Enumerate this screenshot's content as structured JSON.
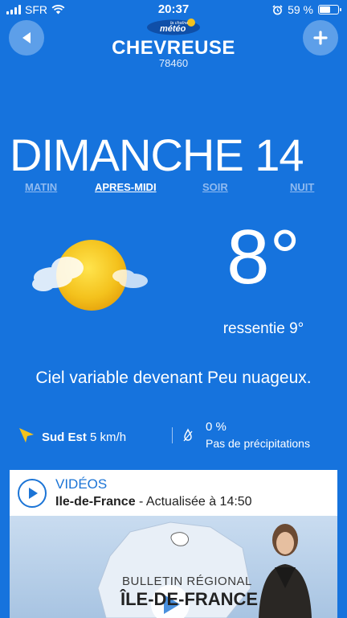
{
  "status_bar": {
    "carrier": "SFR",
    "time": "20:37",
    "battery": "59 %",
    "battery_level": 0.59,
    "icons": [
      "signal-icon",
      "wifi-icon",
      "alarm-icon",
      "battery-icon"
    ]
  },
  "header": {
    "logo_text_top": "la chaîne",
    "logo_text_main": "météo",
    "city": "CHEVREUSE",
    "postal_code": "78460",
    "back_icon": "back-arrow-icon",
    "add_icon": "plus-icon"
  },
  "day": "DIMANCHE 14",
  "tabs": [
    {
      "label": "MATIN",
      "active": false
    },
    {
      "label": "APRES-MIDI",
      "active": true
    },
    {
      "label": "SOIR",
      "active": false
    },
    {
      "label": "NUIT",
      "active": false
    }
  ],
  "weather": {
    "icon": "sun-cloud-icon",
    "temperature": "8°",
    "feels_like": "ressentie 9°",
    "summary": "Ciel variable devenant Peu nuageux."
  },
  "wind": {
    "direction": "Sud Est",
    "speed": "5 km/h",
    "icon": "wind-direction-icon"
  },
  "rain": {
    "probability": "0 %",
    "text": "Pas de précipitations",
    "icon": "umbrella-drop-icon"
  },
  "video_card": {
    "title": "VIDÉOS",
    "region": "Ile-de-France",
    "updated": " - Actualisée à 14:50",
    "thumb_line1": "BULLETIN RÉGIONAL",
    "thumb_line2": "ÎLE-DE-FRANCE"
  },
  "colors": {
    "background": "#1673dd",
    "button": "#5d9fe9",
    "inactive_tab": "#8fbaf0",
    "accent_yellow": "#f4c21d",
    "card_title": "#1b74d6"
  }
}
